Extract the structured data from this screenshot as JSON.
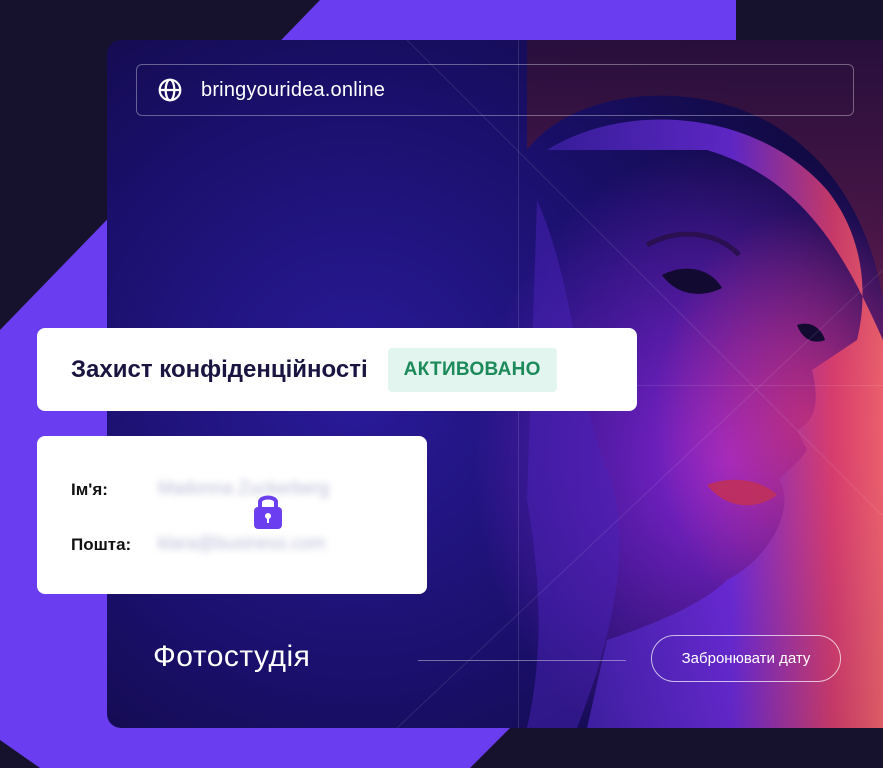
{
  "browser": {
    "url": "bringyouridea.online",
    "globe_icon": "globe-icon"
  },
  "privacy": {
    "title": "Захист конфіденційності",
    "status": "АКТИВОВАНО",
    "status_color": "#1c8a5a"
  },
  "form": {
    "name_label": "Ім'я:",
    "name_value": "Madonna Zuckerberg",
    "email_label": "Пошта:",
    "email_value": "klara@business.com",
    "lock_icon": "lock-icon",
    "lock_color": "#6b3ff0"
  },
  "footer": {
    "studio_title": "Фотостудія",
    "book_button": "Забронювати дату"
  },
  "colors": {
    "accent": "#6a3ef0",
    "dark": "#14102e"
  }
}
